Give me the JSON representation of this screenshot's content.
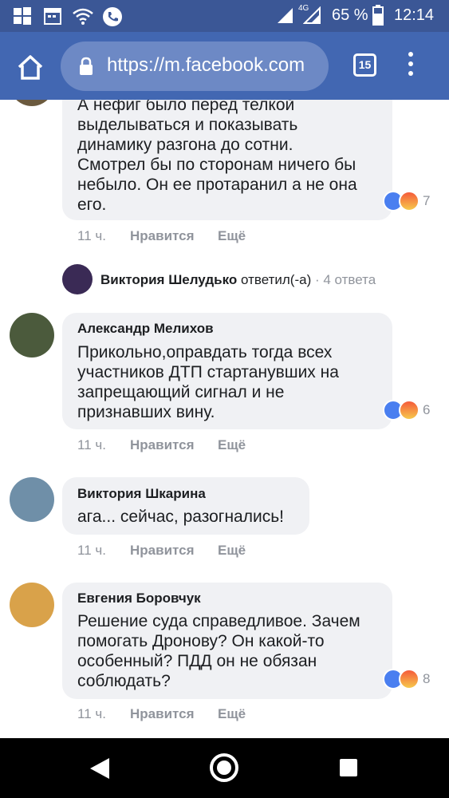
{
  "status_bar": {
    "network_label": "4G",
    "battery": "65 %",
    "time": "12:14"
  },
  "browser": {
    "url": "https://m.facebook.com",
    "tab_count": "15"
  },
  "comments": [
    {
      "author": "",
      "lines": [
        "А нефиг было перед телкой",
        "выделываться и показывать",
        "динамику разгона до сотни.",
        "Смотрел бы по сторонам ничего бы",
        "небыло. Он ее протаранил а не она",
        "его."
      ],
      "time": "11 ч.",
      "like": "Нравится",
      "more": "Ещё",
      "reaction_count": "7"
    },
    {
      "author": "Александр Мелихов",
      "lines": [
        "Прикольно,оправдать тогда всех",
        "участников ДТП стартанувших на",
        "запрещающий сигнал и не",
        "признавших вину."
      ],
      "time": "11 ч.",
      "like": "Нравится",
      "more": "Ещё",
      "reaction_count": "6"
    },
    {
      "author": "Виктория Шкарина",
      "lines": [
        "ага... сейчас, разогнались!"
      ],
      "time": "11 ч.",
      "like": "Нравится",
      "more": "Ещё"
    },
    {
      "author": "Евгения Боровчук",
      "lines": [
        "Решение суда справедливое. Зачем",
        "помогать Дронову? Он какой-то",
        "особенный? ПДД он не обязан",
        "соблюдать?"
      ],
      "time": "11 ч.",
      "like": "Нравится",
      "more": "Ещё",
      "reaction_count": "8"
    }
  ],
  "reply_summary": {
    "name": "Виктория Шелудько",
    "action": "ответил(-а)",
    "separator": " · ",
    "count": "4 ответа"
  },
  "icons": {
    "reactions": [
      "like-icon",
      "angry-icon"
    ]
  },
  "colors": {
    "status_bar": "#3b5796",
    "toolbar": "#4267b2",
    "bubble": "#f0f1f4",
    "like": "#4a7ff0"
  }
}
